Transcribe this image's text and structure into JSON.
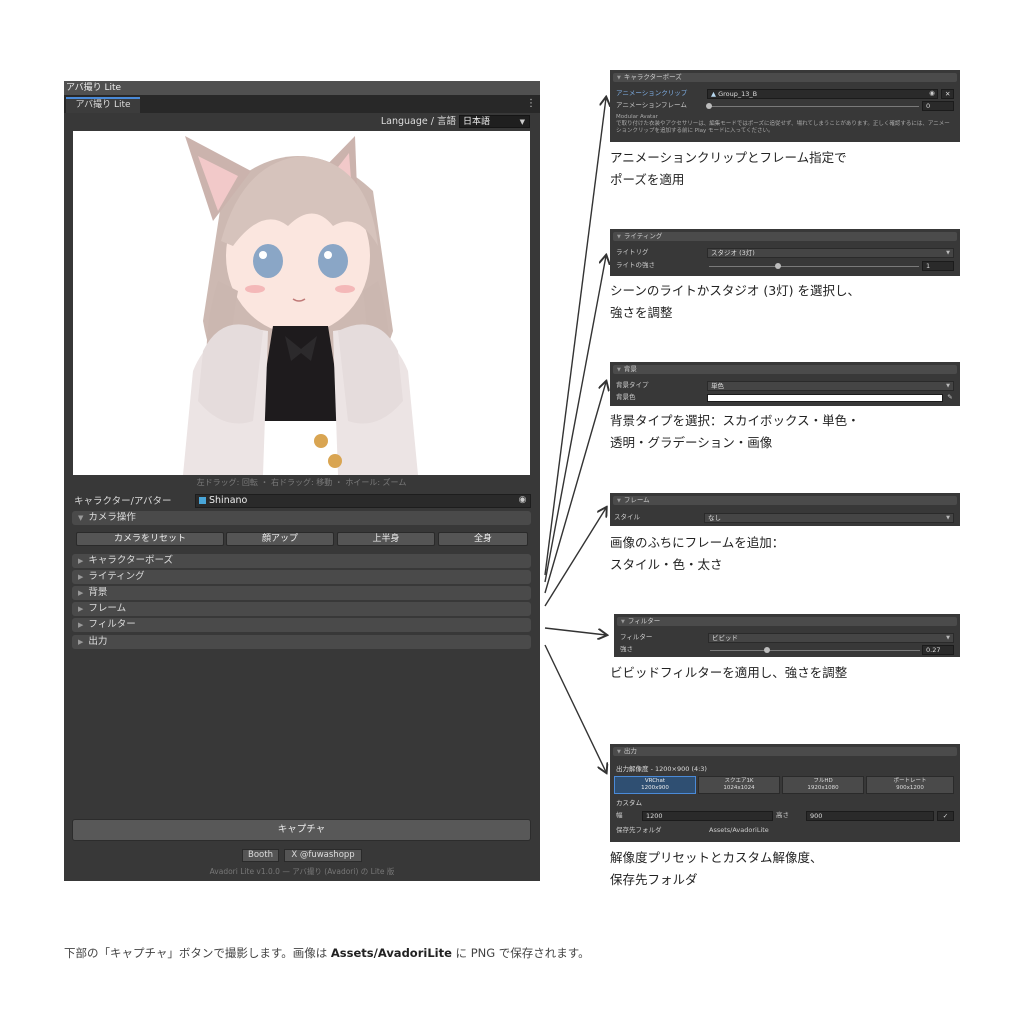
{
  "window": {
    "title": "アバ撮り Lite",
    "tab": "アバ撮り Lite",
    "menu_icon": "kebab-menu-icon",
    "language_label": "Language / 言語",
    "language_value": "日本語",
    "preview_hint": "左ドラッグ: 回転 ・ 右ドラッグ: 移動 ・ ホイール: ズーム",
    "avatar_label": "キャラクター/アバター",
    "avatar_value": "Shinano",
    "camera_section": "カメラ操作",
    "camera_buttons": [
      "カメラをリセット",
      "顔アップ",
      "上半身",
      "全身"
    ],
    "sections": [
      "キャラクターポーズ",
      "ライティング",
      "背景",
      "フレーム",
      "フィルター",
      "出力"
    ],
    "capture_label": "キャプチャ",
    "booth_label": "Booth",
    "x_label": "X @fuwashopp",
    "version": "Avadori Lite v1.0.0 — アバ撮り (Avadori) の Lite 版"
  },
  "panels": {
    "pose": {
      "header": "キャラクターポーズ",
      "clip_label": "アニメーションクリップ",
      "clip_value": "Group_13_B",
      "frame_label": "アニメーションフレーム",
      "frame_value": "0",
      "frame_level": 0,
      "note_title": "Modular Avatar",
      "note_text": "で取り付けた衣装やアクセサリーは、編集モードではポーズに追従せず、場れてしまうことがあります。正しく確認するには、アニメーションクリップを追加する前に Play モードに入ってください。",
      "caption": [
        "アニメーションクリップとフレーム指定で",
        "ポーズを適用"
      ]
    },
    "lighting": {
      "header": "ライティング",
      "rig_label": "ライトリグ",
      "rig_value": "スタジオ (3灯)",
      "intensity_label": "ライトの強さ",
      "intensity_value": "1",
      "intensity_level": 0.33,
      "caption": [
        "シーンのライトかスタジオ (3灯) を選択し、",
        "強さを調整"
      ]
    },
    "background": {
      "header": "背景",
      "type_label": "背景タイプ",
      "type_value": "単色",
      "color_label": "背景色",
      "color_value": "#ffffff",
      "caption": [
        "背景タイプを選択：スカイボックス・単色・",
        "透明・グラデーション・画像"
      ]
    },
    "frame": {
      "header": "フレーム",
      "style_label": "スタイル",
      "style_value": "なし",
      "caption": [
        "画像のふちにフレームを追加：",
        "スタイル・色・太さ"
      ]
    },
    "filter": {
      "header": "フィルター",
      "filter_label": "フィルター",
      "filter_value": "ビビッド",
      "strength_label": "強さ",
      "strength_value": "0.27",
      "strength_level": 0.27,
      "caption": [
        "ビビッドフィルターを適用し、強さを調整"
      ]
    },
    "output": {
      "header": "出力",
      "resolution_label": "出力解像度 - 1200×900 (4:3)",
      "presets": [
        {
          "name": "VRChat",
          "size": "1200x900"
        },
        {
          "name": "スクエア1K",
          "size": "1024x1024"
        },
        {
          "name": "フルHD",
          "size": "1920x1080"
        },
        {
          "name": "ポートレート",
          "size": "900x1200"
        }
      ],
      "custom_label": "カスタム",
      "width_label": "幅",
      "width_value": "1200",
      "height_label": "高さ",
      "height_value": "900",
      "folder_label": "保存先フォルダ",
      "folder_value": "Assets/AvadoriLite",
      "caption": [
        "解像度プリセットとカスタム解像度、",
        "保存先フォルダ"
      ]
    }
  },
  "footer": {
    "prefix": "下部の「キャプチャ」ボタンで撮影します。画像は ",
    "bold": "Assets/AvadoriLite",
    "suffix": " に PNG で保存されます。"
  },
  "colors": {
    "window_bg": "#383838",
    "accent": "#4a8ad8",
    "preset_selected": "#2f4f72",
    "clip_label": "#7fb0e8"
  }
}
